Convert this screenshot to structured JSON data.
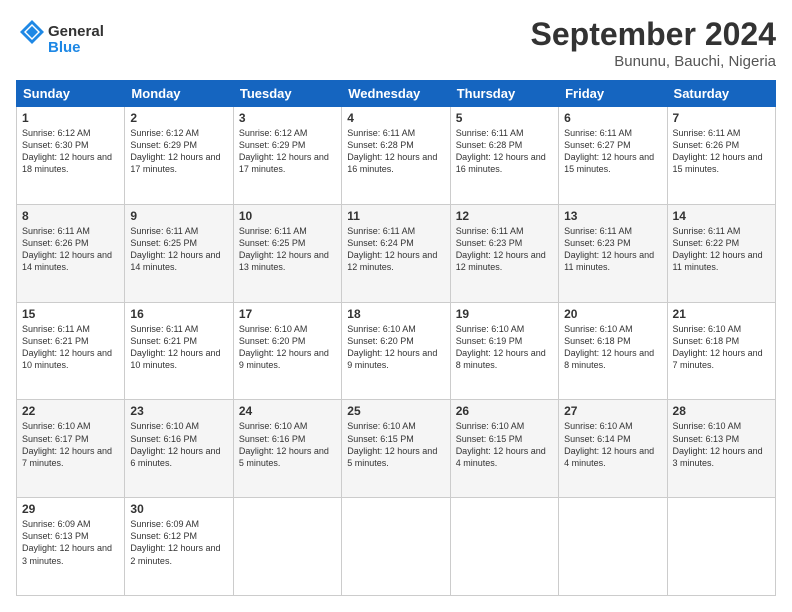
{
  "header": {
    "logo_general": "General",
    "logo_blue": "Blue",
    "month_title": "September 2024",
    "location": "Bununu, Bauchi, Nigeria"
  },
  "weekdays": [
    "Sunday",
    "Monday",
    "Tuesday",
    "Wednesday",
    "Thursday",
    "Friday",
    "Saturday"
  ],
  "weeks": [
    [
      {
        "day": "1",
        "sunrise": "6:12 AM",
        "sunset": "6:30 PM",
        "daylight": "12 hours and 18 minutes."
      },
      {
        "day": "2",
        "sunrise": "6:12 AM",
        "sunset": "6:29 PM",
        "daylight": "12 hours and 17 minutes."
      },
      {
        "day": "3",
        "sunrise": "6:12 AM",
        "sunset": "6:29 PM",
        "daylight": "12 hours and 17 minutes."
      },
      {
        "day": "4",
        "sunrise": "6:11 AM",
        "sunset": "6:28 PM",
        "daylight": "12 hours and 16 minutes."
      },
      {
        "day": "5",
        "sunrise": "6:11 AM",
        "sunset": "6:28 PM",
        "daylight": "12 hours and 16 minutes."
      },
      {
        "day": "6",
        "sunrise": "6:11 AM",
        "sunset": "6:27 PM",
        "daylight": "12 hours and 15 minutes."
      },
      {
        "day": "7",
        "sunrise": "6:11 AM",
        "sunset": "6:26 PM",
        "daylight": "12 hours and 15 minutes."
      }
    ],
    [
      {
        "day": "8",
        "sunrise": "6:11 AM",
        "sunset": "6:26 PM",
        "daylight": "12 hours and 14 minutes."
      },
      {
        "day": "9",
        "sunrise": "6:11 AM",
        "sunset": "6:25 PM",
        "daylight": "12 hours and 14 minutes."
      },
      {
        "day": "10",
        "sunrise": "6:11 AM",
        "sunset": "6:25 PM",
        "daylight": "12 hours and 13 minutes."
      },
      {
        "day": "11",
        "sunrise": "6:11 AM",
        "sunset": "6:24 PM",
        "daylight": "12 hours and 12 minutes."
      },
      {
        "day": "12",
        "sunrise": "6:11 AM",
        "sunset": "6:23 PM",
        "daylight": "12 hours and 12 minutes."
      },
      {
        "day": "13",
        "sunrise": "6:11 AM",
        "sunset": "6:23 PM",
        "daylight": "12 hours and 11 minutes."
      },
      {
        "day": "14",
        "sunrise": "6:11 AM",
        "sunset": "6:22 PM",
        "daylight": "12 hours and 11 minutes."
      }
    ],
    [
      {
        "day": "15",
        "sunrise": "6:11 AM",
        "sunset": "6:21 PM",
        "daylight": "12 hours and 10 minutes."
      },
      {
        "day": "16",
        "sunrise": "6:11 AM",
        "sunset": "6:21 PM",
        "daylight": "12 hours and 10 minutes."
      },
      {
        "day": "17",
        "sunrise": "6:10 AM",
        "sunset": "6:20 PM",
        "daylight": "12 hours and 9 minutes."
      },
      {
        "day": "18",
        "sunrise": "6:10 AM",
        "sunset": "6:20 PM",
        "daylight": "12 hours and 9 minutes."
      },
      {
        "day": "19",
        "sunrise": "6:10 AM",
        "sunset": "6:19 PM",
        "daylight": "12 hours and 8 minutes."
      },
      {
        "day": "20",
        "sunrise": "6:10 AM",
        "sunset": "6:18 PM",
        "daylight": "12 hours and 8 minutes."
      },
      {
        "day": "21",
        "sunrise": "6:10 AM",
        "sunset": "6:18 PM",
        "daylight": "12 hours and 7 minutes."
      }
    ],
    [
      {
        "day": "22",
        "sunrise": "6:10 AM",
        "sunset": "6:17 PM",
        "daylight": "12 hours and 7 minutes."
      },
      {
        "day": "23",
        "sunrise": "6:10 AM",
        "sunset": "6:16 PM",
        "daylight": "12 hours and 6 minutes."
      },
      {
        "day": "24",
        "sunrise": "6:10 AM",
        "sunset": "6:16 PM",
        "daylight": "12 hours and 5 minutes."
      },
      {
        "day": "25",
        "sunrise": "6:10 AM",
        "sunset": "6:15 PM",
        "daylight": "12 hours and 5 minutes."
      },
      {
        "day": "26",
        "sunrise": "6:10 AM",
        "sunset": "6:15 PM",
        "daylight": "12 hours and 4 minutes."
      },
      {
        "day": "27",
        "sunrise": "6:10 AM",
        "sunset": "6:14 PM",
        "daylight": "12 hours and 4 minutes."
      },
      {
        "day": "28",
        "sunrise": "6:10 AM",
        "sunset": "6:13 PM",
        "daylight": "12 hours and 3 minutes."
      }
    ],
    [
      {
        "day": "29",
        "sunrise": "6:09 AM",
        "sunset": "6:13 PM",
        "daylight": "12 hours and 3 minutes."
      },
      {
        "day": "30",
        "sunrise": "6:09 AM",
        "sunset": "6:12 PM",
        "daylight": "12 hours and 2 minutes."
      },
      null,
      null,
      null,
      null,
      null
    ]
  ]
}
